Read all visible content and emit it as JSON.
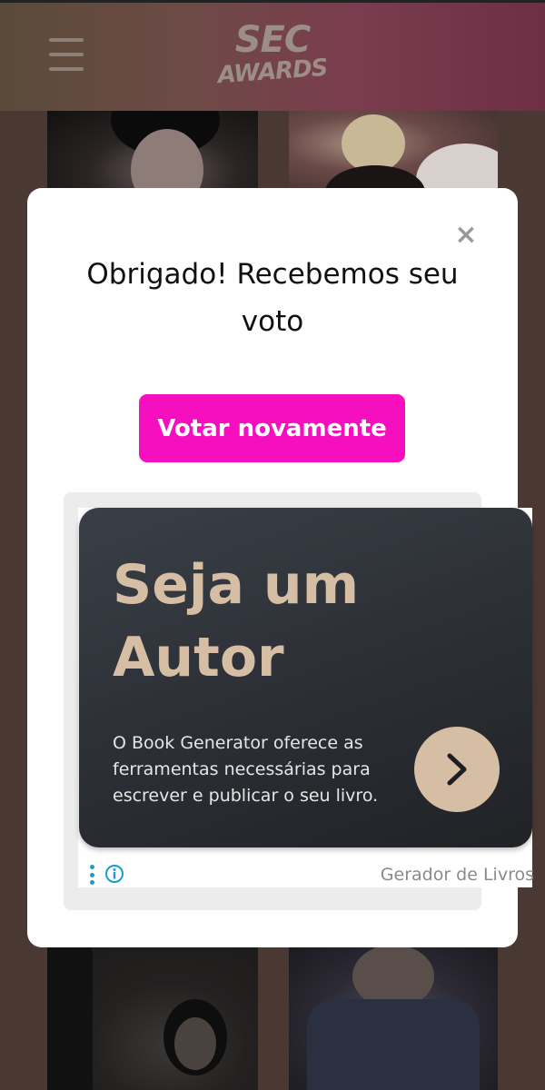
{
  "header": {
    "logo_line1": "SEC",
    "logo_line2": "AWARDS",
    "menu_icon": "hamburger-menu-icon"
  },
  "modal": {
    "close_symbol": "×",
    "title": "Obrigado! Recebemos seu voto",
    "vote_again_label": "Votar novamente",
    "accent_color": "#f50fbf"
  },
  "ad": {
    "headline": "Seja um Autor",
    "body": "O Book Generator oferece as ferramentas necessárias para escrever e publicar o seu livro.",
    "cta_icon": "chevron-right-icon",
    "sponsor": "Gerador de Livros",
    "options_icon": "vertical-dots-icon",
    "info_icon": "info-icon",
    "accent_color": "#d5bea3",
    "card_color": "#2b2e34"
  }
}
